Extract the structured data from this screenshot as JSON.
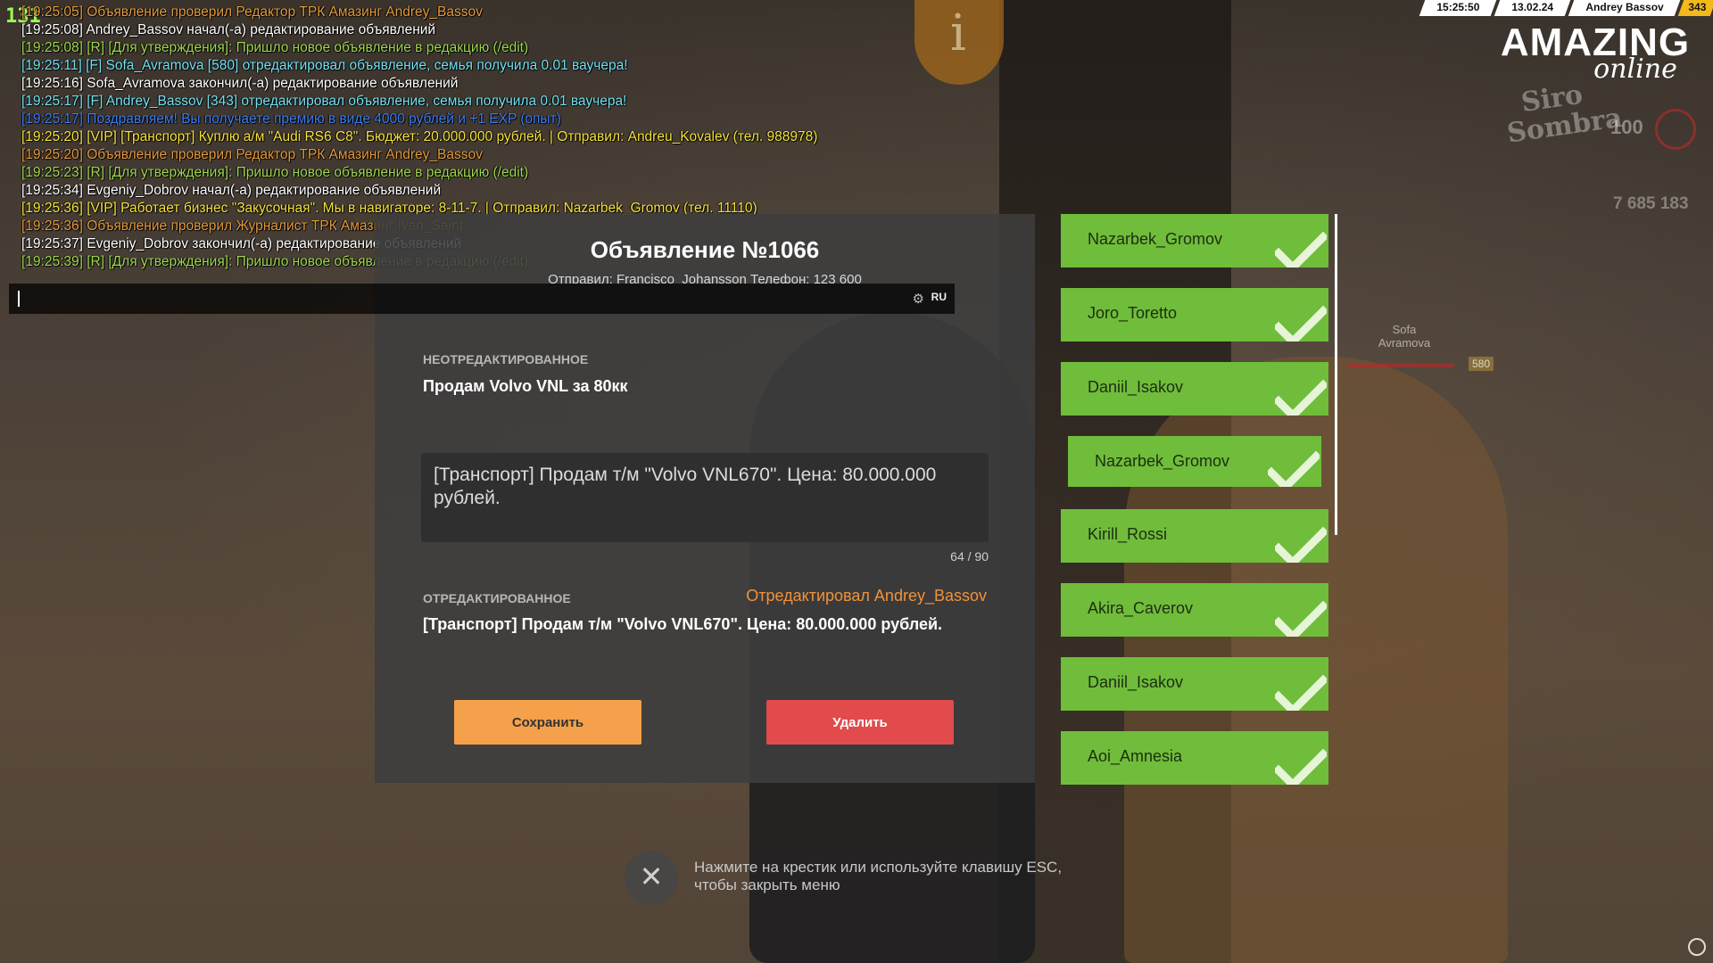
{
  "hud": {
    "fps": "131",
    "time": "15:25:50",
    "date": "13.02.24",
    "player_name": "Andrey Bassov",
    "player_id": "343",
    "logo_main": "AMAZING",
    "logo_sub": "online",
    "emblem_text": "Siro Sombra",
    "health": "100",
    "money": "7 685 183",
    "nearby_player_name": "Sofa Avramova",
    "nearby_player_id": "580",
    "info_sign": "i"
  },
  "chat": {
    "lines": [
      {
        "color": "orange",
        "text": "[19:25:05] Объявление проверил Редактор ТРК Амазинг Andrey_Bassov"
      },
      {
        "color": "white",
        "text": "[19:25:08] Andrey_Bassov начал(-а) редактирование объявлений"
      },
      {
        "color": "green",
        "text": "[19:25:08] [R] [Для утверждения]: Пришло новое объявление в редакцию (/edit)"
      },
      {
        "color": "cyan",
        "text": "[19:25:11] [F] Sofa_Avramova [580] отредактировал объявление, семья получила 0.01 ваучера!"
      },
      {
        "color": "white",
        "text": "[19:25:16] Sofa_Avramova закончил(-а) редактирование объявлений"
      },
      {
        "color": "cyan",
        "text": "[19:25:17] [F] Andrey_Bassov [343] отредактировал объявление, семья получила 0.01 ваучера!"
      },
      {
        "color": "blue",
        "text": "[19:25:17] Поздравляем! Вы получаете премию в виде 4000 рублей и +1 EXP (опыт)"
      },
      {
        "color": "yellow",
        "text": "[19:25:20] [VIP] [Транспорт] Куплю а/м \"Audi RS6 C8\". Бюджет: 20.000.000 рублей. | Отправил: Andreu_Kovalev (тел. 988978)"
      },
      {
        "color": "orange",
        "text": "[19:25:20] Объявление проверил Редактор ТРК Амазинг Andrey_Bassov"
      },
      {
        "color": "green",
        "text": "[19:25:23] [R] [Для утверждения]: Пришло новое объявление в редакцию (/edit)"
      },
      {
        "color": "white",
        "text": "[19:25:34] Evgeniy_Dobrov начал(-а) редактирование объявлений"
      },
      {
        "color": "yellow",
        "text": "[19:25:36] [VIP] Работает бизнес \"Закусочная\". Мы в навигаторе: 8-11-7. | Отправил: Nazarbek_Gromov (тел. 11110)"
      },
      {
        "color": "orange",
        "text": "[19:25:36] Объявление проверил Журналист ТРК Амазинг Ivan_Saint"
      },
      {
        "color": "white",
        "text": "[19:25:37] Evgeniy_Dobrov закончил(-а) редактирование объявлений"
      },
      {
        "color": "green",
        "text": "[19:25:39] [R] [Для утверждения]: Пришло новое объявление в редакцию (/edit)"
      }
    ],
    "input_value": "",
    "language": "RU",
    "settings_icon": "gear-icon"
  },
  "modal": {
    "title": "Объявление №1066",
    "sender": "Отправил: Francisco_Johansson Телефон: 123 600",
    "original_label": "НЕОТРЕДАКТИРОВАННОЕ",
    "original_text": "Продам Volvo VNL за 80кк",
    "edit_value": "[Транспорт] Продам т/м \"Volvo VNL670\". Цена: 80.000.000 рублей.",
    "char_counter": "64 / 90",
    "edited_label": "ОТРЕДАКТИРОВАННОЕ",
    "edited_by": "Отредактировал Andrey_Bassov",
    "edited_text": "[Транспорт] Продам т/м \"Volvo VNL670\". Цена: 80.000.000 рублей.",
    "save_label": "Сохранить",
    "delete_label": "Удалить"
  },
  "editors": {
    "items": [
      {
        "name": "Nazarbek_Gromov"
      },
      {
        "name": "Joro_Toretto"
      },
      {
        "name": "Daniil_Isakov"
      },
      {
        "name": "Nazarbek_Gromov"
      },
      {
        "name": "Kirill_Rossi"
      },
      {
        "name": "Akira_Caverov"
      },
      {
        "name": "Daniil_Isakov"
      },
      {
        "name": "Aoi_Amnesia"
      }
    ],
    "card_color": "#6fbd3a"
  },
  "close": {
    "icon": "close-icon",
    "hint": "Нажмите на крестик или используйте клавишу ESC, чтобы закрыть меню"
  }
}
